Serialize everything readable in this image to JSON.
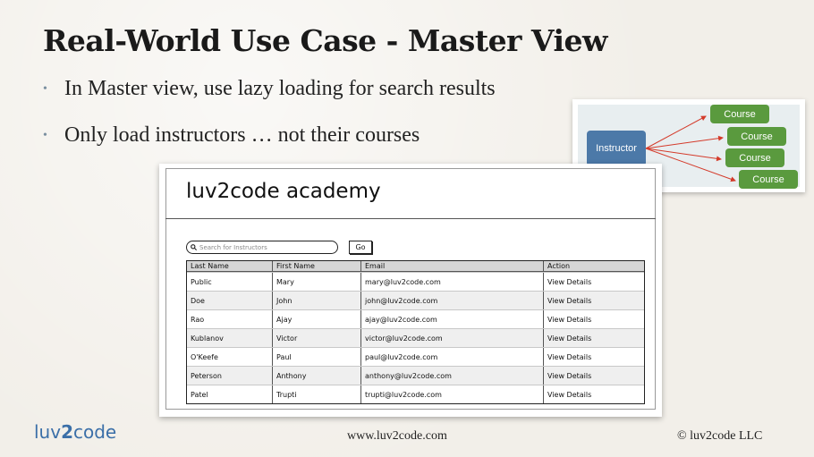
{
  "slide": {
    "title": "Real-World Use Case - Master View",
    "bullets": [
      "In Master view, use lazy loading for search results",
      "Only load instructors … not their courses"
    ]
  },
  "diagram": {
    "instructor_label": "Instructor",
    "course_labels": [
      "Course",
      "Course",
      "Course",
      "Course"
    ],
    "colors": {
      "instructor": "#4c79a8",
      "course": "#5a9a3e",
      "arrow": "#d43a2a"
    }
  },
  "mockup": {
    "app_title": "luv2code academy",
    "search_placeholder": "Search for Instructors",
    "go_label": "Go",
    "columns": [
      "Last Name",
      "First Name",
      "Email",
      "Action"
    ],
    "rows": [
      [
        "Public",
        "Mary",
        "mary@luv2code.com",
        "View Details"
      ],
      [
        "Doe",
        "John",
        "john@luv2code.com",
        "View Details"
      ],
      [
        "Rao",
        "Ajay",
        "ajay@luv2code.com",
        "View Details"
      ],
      [
        "Kublanov",
        "Victor",
        "victor@luv2code.com",
        "View Details"
      ],
      [
        "O'Keefe",
        "Paul",
        "paul@luv2code.com",
        "View Details"
      ],
      [
        "Peterson",
        "Anthony",
        "anthony@luv2code.com",
        "View Details"
      ],
      [
        "Patel",
        "Trupti",
        "trupti@luv2code.com",
        "View Details"
      ]
    ]
  },
  "footer": {
    "logo_left": "luv",
    "logo_two": "2",
    "logo_right": "code",
    "url": "www.luv2code.com",
    "copyright": "© luv2code LLC"
  }
}
